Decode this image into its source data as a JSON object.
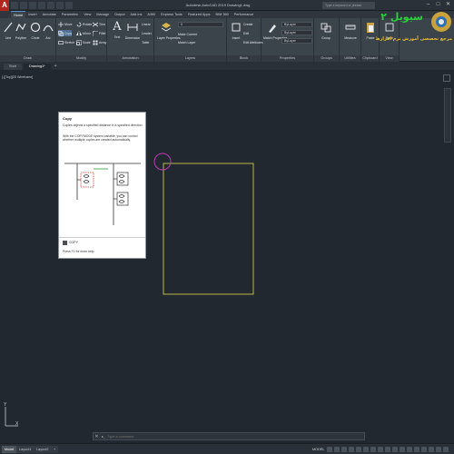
{
  "app": {
    "logo_letter": "A",
    "title": "Autodesk AutoCAD 2019  Drawing1.dwg",
    "search_placeholder": "Type a keyword or phrase"
  },
  "ribbon": {
    "tabs": [
      "Home",
      "Insert",
      "Annotate",
      "Parametric",
      "View",
      "Manage",
      "Output",
      "Add-ins",
      "A360",
      "Express Tools",
      "Featured Apps",
      "BIM 360",
      "Performance"
    ],
    "active_tab": "Home",
    "draw": {
      "title": "Draw",
      "tools": [
        "Line",
        "Polyline",
        "Circle",
        "Arc"
      ]
    },
    "modify": {
      "title": "Modify",
      "tools": [
        "Move",
        "Rotate",
        "Trim",
        "Copy",
        "Mirror",
        "Fillet",
        "Stretch",
        "Scale",
        "Array"
      ]
    },
    "annotation": {
      "title": "Annotation",
      "tools": [
        "Text",
        "Dimension",
        "Linear",
        "Leader",
        "Table"
      ]
    },
    "layers": {
      "title": "Layers",
      "layer_properties": "Layer Properties",
      "current_layer": "0",
      "make_current": "Make Current",
      "match_layer": "Match Layer"
    },
    "block": {
      "title": "Block",
      "insert": "Insert",
      "create": "Create",
      "edit": "Edit",
      "edit_attributes": "Edit Attributes"
    },
    "properties": {
      "title": "Properties",
      "match_properties": "Match Properties",
      "color": "ByLayer",
      "linetype": "ByLayer",
      "lineweight": "ByLayer"
    },
    "groups": {
      "title": "Groups",
      "group": "Group"
    },
    "utilities": {
      "title": "Utilities",
      "measure": "Measure"
    },
    "clipboard": {
      "title": "Clipboard",
      "paste": "Paste"
    },
    "view": {
      "title": "View",
      "base": "Base"
    }
  },
  "file_tabs": [
    "Start",
    "Drawing1*"
  ],
  "viewport": {
    "label": "[-][Top][2D Wireframe]"
  },
  "tooltip": {
    "title": "Copy",
    "description": "Copies objects a specified distance in a specified direction",
    "details": "With the COPYMODE system variable, you can control whether multiple copies are created automatically.",
    "command": "COPY",
    "help": "Press F1 for more help"
  },
  "ucs": {
    "x_label": "X",
    "y_label": "Y"
  },
  "command_line": {
    "prompt": "▸_",
    "placeholder": "Type a command"
  },
  "status_bar": {
    "layout_tabs": [
      "Model",
      "Layout1",
      "Layout2"
    ],
    "active_layout": "Model",
    "space": "MODEL"
  },
  "watermark": {
    "brand": "سیویل ۲",
    "caption": "مرجع تخصصی آموزش نرم افزارهای عمران"
  },
  "colors": {
    "canvas": "#212830",
    "drawn_rectangle": "#b7b94a",
    "cursor_circle": "#c23ab8",
    "accent": "#5a8fd0"
  }
}
